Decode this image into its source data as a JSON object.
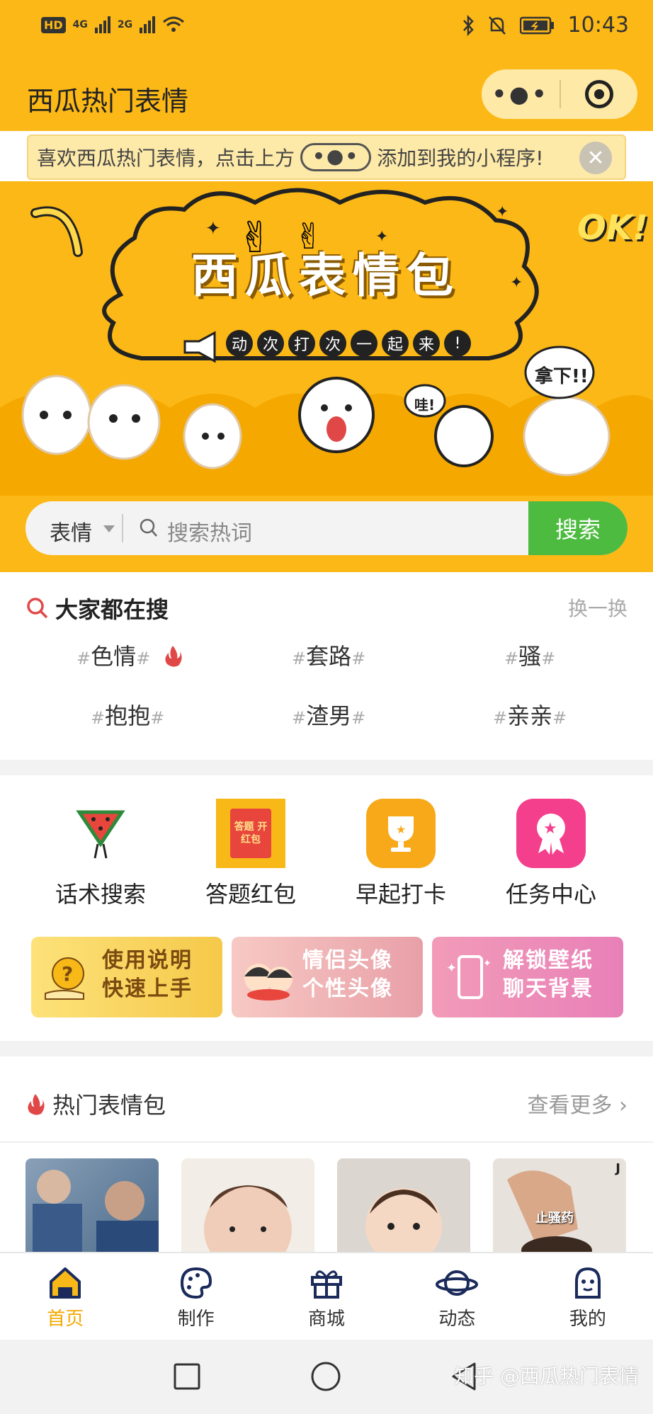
{
  "status_bar": {
    "network_badge": "HD",
    "sig1": "4G",
    "sig2": "2G",
    "time": "10:43"
  },
  "app": {
    "title": "西瓜热门表情"
  },
  "tip": {
    "text_before": "喜欢西瓜热门表情，点击上方",
    "pill": "•●•",
    "text_after": "添加到我的小程序!"
  },
  "banner": {
    "title": "西瓜表情包",
    "slogan": [
      "动",
      "次",
      "打",
      "次",
      "一",
      "起",
      "来",
      "!"
    ],
    "ok": "OK!",
    "wa": "哇!",
    "naxia": "拿下!!"
  },
  "search": {
    "category": "表情",
    "placeholder": "搜索热词",
    "button": "搜索"
  },
  "hot_search": {
    "title": "大家都在搜",
    "refresh": "换一换",
    "keywords": [
      "色情",
      "套路",
      "骚",
      "抱抱",
      "渣男",
      "亲亲"
    ]
  },
  "features": {
    "items": [
      {
        "label": "话术搜索",
        "icon": "watermelon-icon"
      },
      {
        "label": "答题红包",
        "icon": "red-envelope-icon",
        "icon_text": "答题 开红包"
      },
      {
        "label": "早起打卡",
        "icon": "trophy-icon"
      },
      {
        "label": "任务中心",
        "icon": "ribbon-star-icon"
      }
    ],
    "cards": [
      {
        "line1": "使用说明",
        "line2": "快速上手"
      },
      {
        "line1": "情侣头像",
        "line2": "个性头像"
      },
      {
        "line1": "解锁壁纸",
        "line2": "聊天背景"
      }
    ]
  },
  "popular": {
    "title": "热门表情包",
    "more": "查看更多",
    "thumb4_text": "止骚药",
    "thumb4_tag": "J"
  },
  "tabbar": {
    "items": [
      {
        "label": "首页",
        "icon": "home-icon"
      },
      {
        "label": "制作",
        "icon": "palette-icon"
      },
      {
        "label": "商城",
        "icon": "gift-icon"
      },
      {
        "label": "动态",
        "icon": "planet-icon"
      },
      {
        "label": "我的",
        "icon": "profile-icon"
      }
    ]
  },
  "watermark": "知乎 @西瓜热门表情",
  "colors": {
    "brand_yellow": "#fbb816",
    "search_green": "#4cbb3f",
    "active_tab": "#f2a900"
  }
}
